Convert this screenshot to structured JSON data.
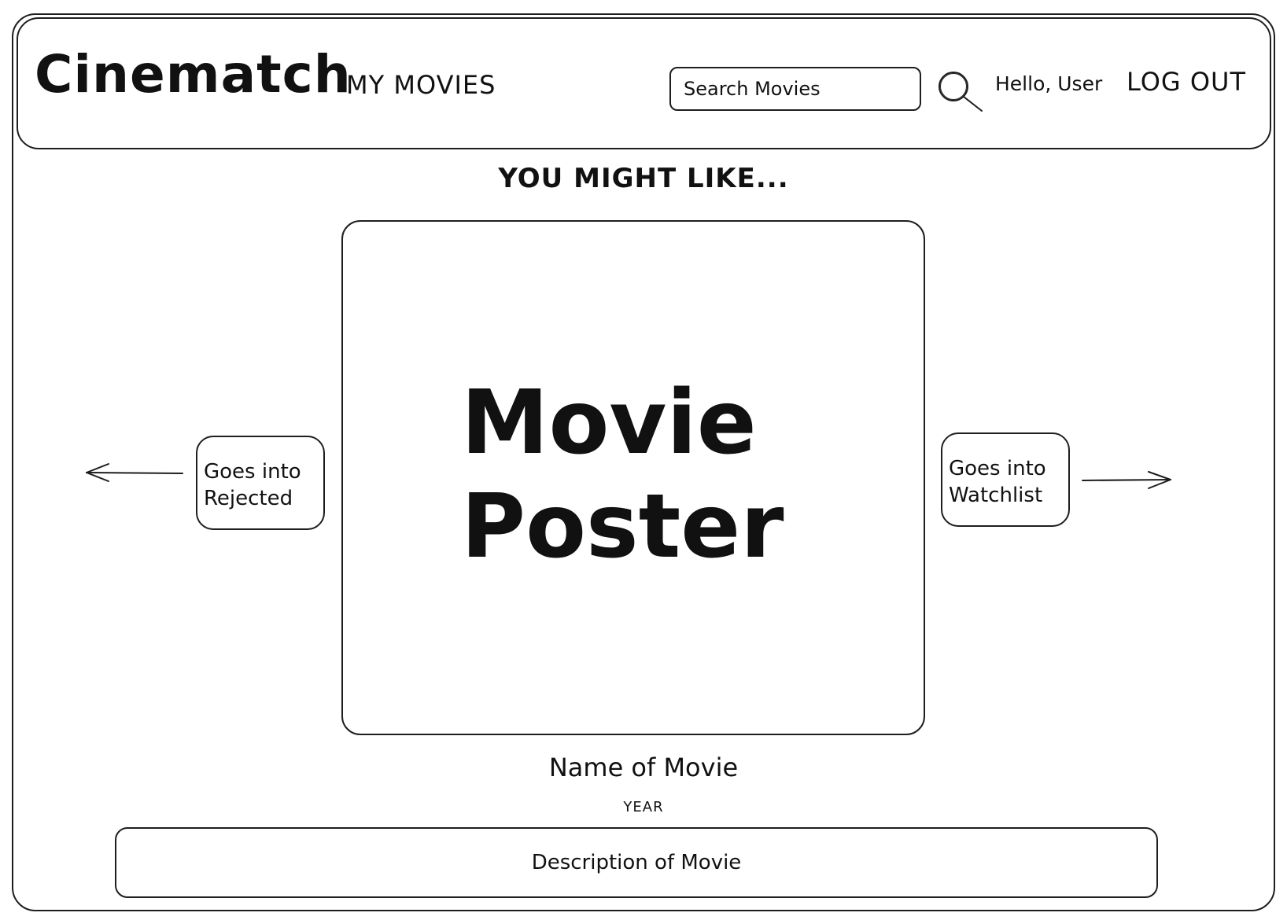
{
  "app": {
    "logo": "Cinematch"
  },
  "header": {
    "nav": {
      "my_movies": "MY MOVIES"
    },
    "search": {
      "placeholder": "Search Movies",
      "icon": "search-icon"
    },
    "greeting": "Hello, User",
    "logout_label": "LOG OUT"
  },
  "main": {
    "section_title": "YOU MIGHT LIKE...",
    "poster": {
      "label": "Movie\nPoster"
    },
    "reject": {
      "label": "Goes into\nRejected",
      "arrow_icon": "arrow-left-icon"
    },
    "watchlist": {
      "label": "Goes into\nWatchlist",
      "arrow_icon": "arrow-right-icon"
    },
    "movie": {
      "name": "Name of Movie",
      "year": "YEAR",
      "description": "Description of Movie"
    }
  }
}
